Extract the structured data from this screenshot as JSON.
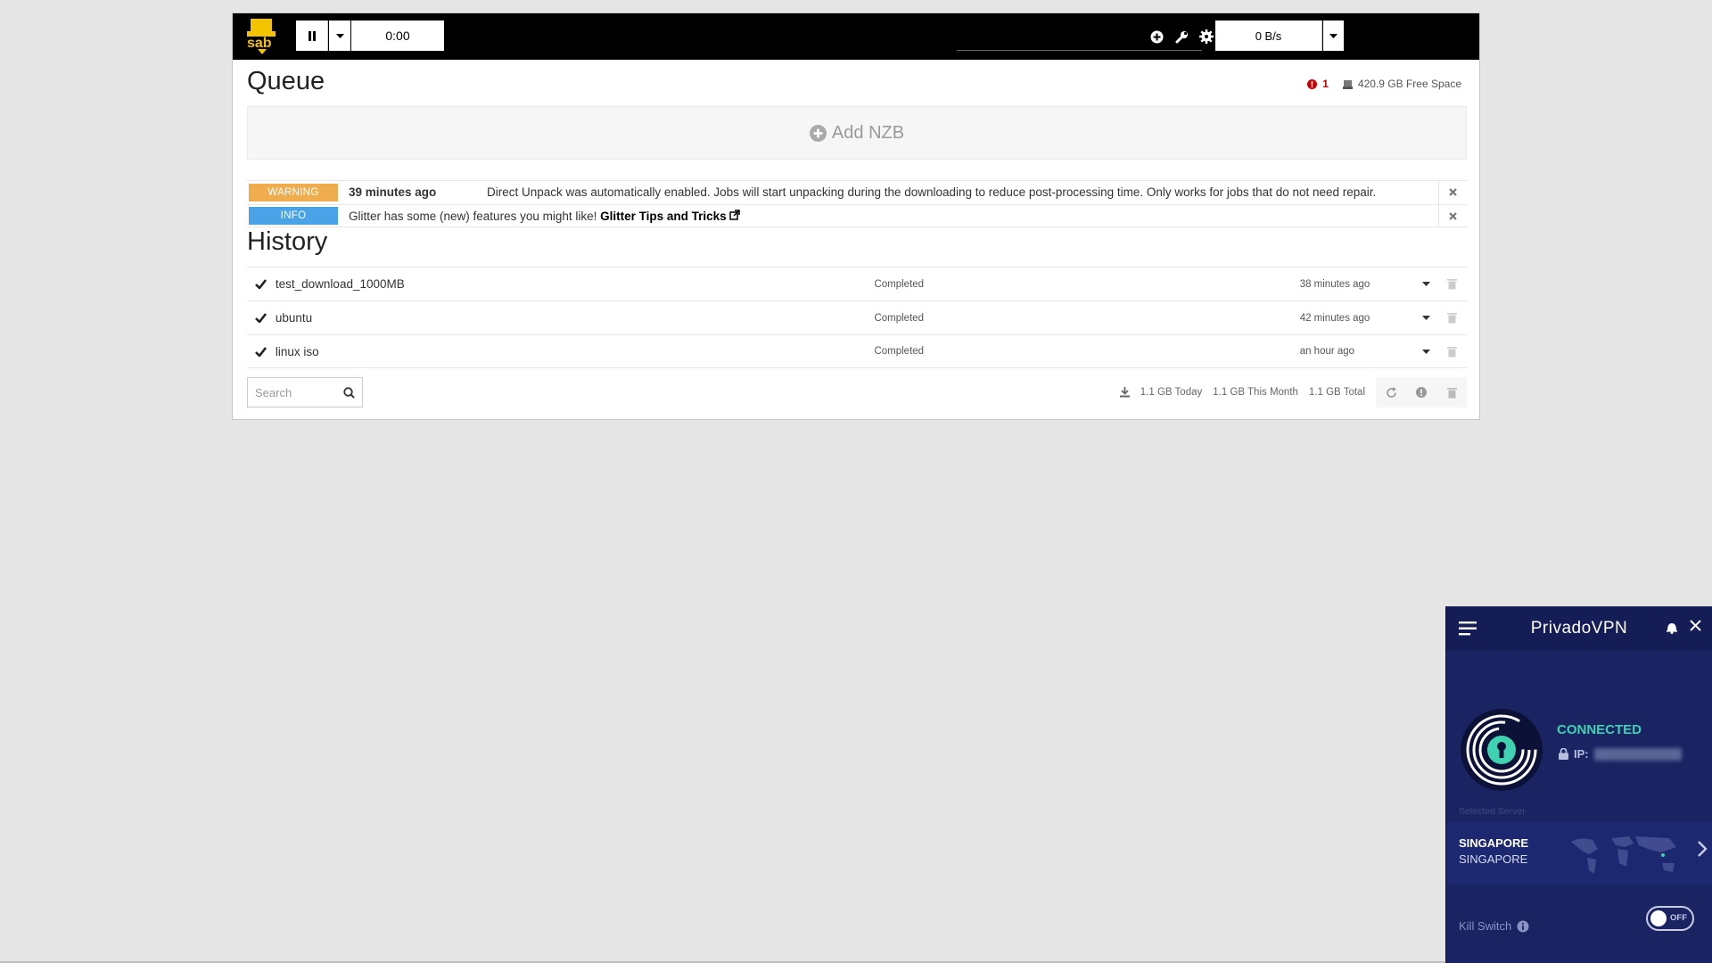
{
  "sab": {
    "logo_text": "sab",
    "timer": "0:00",
    "speed": "0 B/s",
    "queue_title": "Queue",
    "error_count": "1",
    "free_space": "420.9 GB Free Space",
    "add_nzb": "Add NZB",
    "messages": [
      {
        "type": "WARNING",
        "time": "39 minutes ago",
        "text": "Direct Unpack was automatically enabled. Jobs will start unpacking during the downloading to reduce post-processing time. Only works for jobs that do not need repair."
      },
      {
        "type": "INFO",
        "text": "Glitter has some (new) features you might like!",
        "link": "Glitter Tips and Tricks"
      }
    ],
    "history_title": "History",
    "history": [
      {
        "name": "test_download_1000MB",
        "status": "Completed",
        "time": "38 minutes ago"
      },
      {
        "name": "ubuntu",
        "status": "Completed",
        "time": "42 minutes ago"
      },
      {
        "name": "linux iso",
        "status": "Completed",
        "time": "an hour ago"
      }
    ],
    "search_placeholder": "Search",
    "stats": {
      "today": "1.1 GB Today",
      "month": "1.1 GB This Month",
      "total": "1.1 GB Total"
    },
    "colors": {
      "warning": "#f0ad4e",
      "info": "#4aa3e6",
      "topbar": "#000000"
    }
  },
  "vpn": {
    "title": "PrivadoVPN",
    "status": "CONNECTED",
    "ip_label": "IP:",
    "selected_label": "Selected Server",
    "country": "SINGAPORE",
    "city": "SINGAPORE",
    "kill_switch": "Kill Switch",
    "toggle": "OFF",
    "colors": {
      "bg": "#1a2463",
      "connected": "#3ed2b0"
    }
  }
}
